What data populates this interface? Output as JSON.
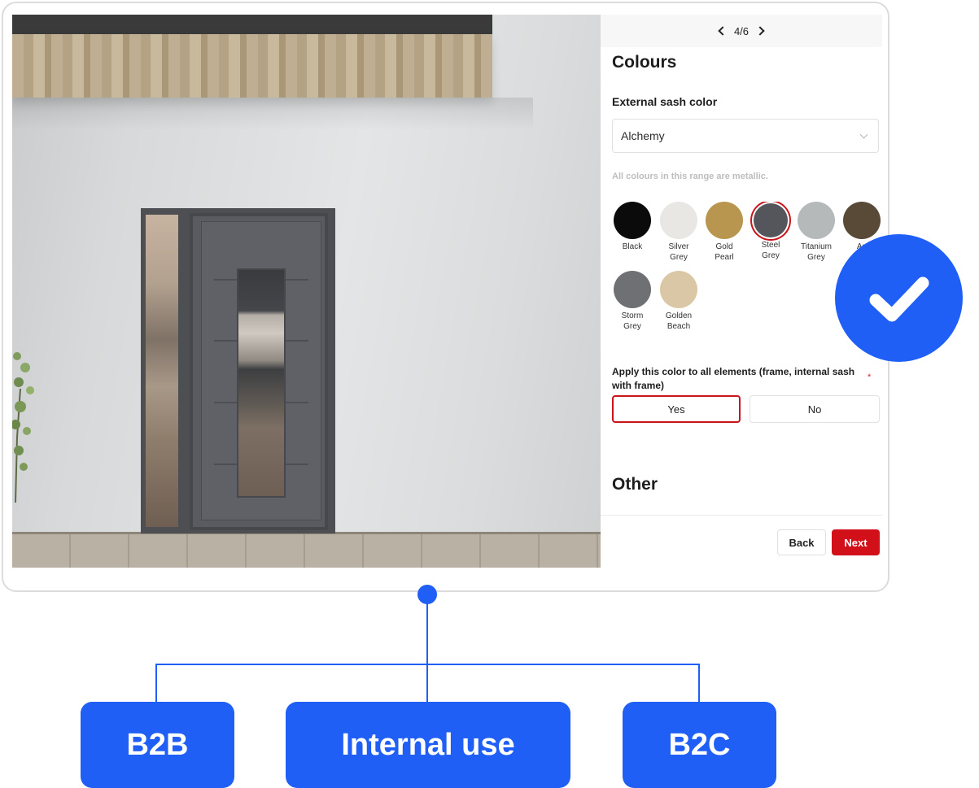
{
  "pager": {
    "text": "4/6"
  },
  "colours": {
    "heading": "Colours",
    "external_sash_label": "External sash color",
    "range_select": {
      "value": "Alchemy"
    },
    "note": "All colours in this range are metallic.",
    "swatches": [
      {
        "line1": "Black",
        "line2": "",
        "color": "#0b0b0b",
        "selected": false
      },
      {
        "line1": "Silver",
        "line2": "Grey",
        "color": "#e9e7e4",
        "selected": false
      },
      {
        "line1": "Gold",
        "line2": "Pearl",
        "color": "#b8964f",
        "selected": false
      },
      {
        "line1": "Steel",
        "line2": "Grey",
        "color": "#55565b",
        "selected": true
      },
      {
        "line1": "Titanium",
        "line2": "Grey",
        "color": "#b6b9b9",
        "selected": false
      },
      {
        "line1": "An",
        "line2": "",
        "color": "#594a37",
        "selected": false
      },
      {
        "line1": "Storm",
        "line2": "Grey",
        "color": "#6f7074",
        "selected": false
      },
      {
        "line1": "Golden",
        "line2": "Beach",
        "color": "#d9c7a6",
        "selected": false
      }
    ],
    "apply_question": "Apply this color to all elements (frame, internal sash with frame)",
    "required_mark": "*",
    "options": {
      "yes": "Yes",
      "no": "No"
    }
  },
  "other_heading": "Other",
  "nav": {
    "back": "Back",
    "next": "Next"
  },
  "tags": {
    "b2b": "B2B",
    "internal": "Internal use",
    "b2c": "B2C"
  },
  "accent_colors": {
    "brand_blue": "#1f5ff5",
    "action_red": "#d2101a"
  }
}
